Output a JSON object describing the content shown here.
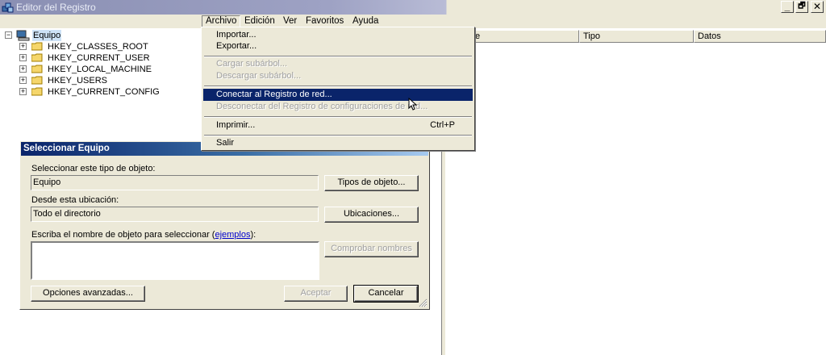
{
  "window": {
    "title": "Editor del Registro",
    "minimize_glyph": "_",
    "restore_glyph": "🗗",
    "close_glyph": "✕"
  },
  "menu": {
    "items": [
      "Archivo",
      "Edición",
      "Ver",
      "Favoritos",
      "Ayuda"
    ]
  },
  "archivo_menu": {
    "importar": "Importar...",
    "exportar": "Exportar...",
    "cargar": "Cargar subárbol...",
    "descargar": "Descargar subárbol...",
    "conectar": "Conectar al Registro de red...",
    "desconectar": "Desconectar del Registro de configuraciones de red...",
    "imprimir": "Imprimir...",
    "imprimir_shortcut": "Ctrl+P",
    "salir": "Salir"
  },
  "tree": {
    "root": "Equipo",
    "keys": [
      "HKEY_CLASSES_ROOT",
      "HKEY_CURRENT_USER",
      "HKEY_LOCAL_MACHINE",
      "HKEY_USERS",
      "HKEY_CURRENT_CONFIG"
    ],
    "expanded_glyph": "−",
    "collapsed_glyph": "+"
  },
  "list": {
    "columns": [
      "e",
      "Tipo",
      "Datos"
    ]
  },
  "dialog": {
    "title": "Seleccionar Equipo",
    "object_type_label": "Seleccionar este tipo de objeto:",
    "object_type_value": "Equipo",
    "object_types_button": "Tipos de objeto...",
    "location_label": "Desde esta ubicación:",
    "location_value": "Todo el directorio",
    "locations_button": "Ubicaciones...",
    "name_label_prefix": "Escriba el nombre de objeto para seleccionar (",
    "name_label_link": "ejemplos",
    "name_label_suffix": "):",
    "name_value": "",
    "check_names_button": "Comprobar nombres",
    "advanced_button": "Opciones avanzadas...",
    "ok_button": "Aceptar",
    "cancel_button": "Cancelar"
  },
  "colors": {
    "menu_highlight": "#0a246a",
    "dialog_title_start": "#0a246a",
    "dialog_title_end": "#a6caf0",
    "face": "#ece9d8"
  }
}
